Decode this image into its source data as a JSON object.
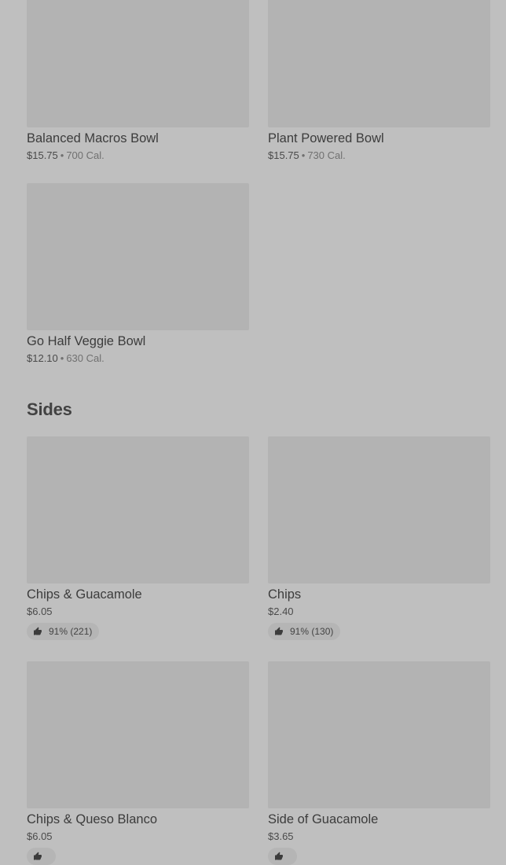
{
  "bowls": [
    {
      "name": "Balanced Macros Bowl",
      "price": "$15.75",
      "separator": "•",
      "calories": "700 Cal."
    },
    {
      "name": "Plant Powered Bowl",
      "price": "$15.75",
      "separator": "•",
      "calories": "730 Cal."
    },
    {
      "name": "Go Half Veggie Bowl",
      "price": "$12.10",
      "separator": "•",
      "calories": "630 Cal."
    }
  ],
  "sides_section": {
    "title": "Sides"
  },
  "sides": [
    {
      "name": "Chips & Guacamole",
      "price": "$6.05",
      "rating": "91% (221)",
      "icon": "thumbs-up-icon"
    },
    {
      "name": "Chips",
      "price": "$2.40",
      "rating": "91% (130)",
      "icon": "thumbs-up-icon"
    },
    {
      "name": "Chips & Queso Blanco",
      "price": "$6.05",
      "rating": "",
      "icon": "thumbs-up-icon"
    },
    {
      "name": "Side of Guacamole",
      "price": "$3.65",
      "rating": "",
      "icon": "thumbs-up-icon"
    }
  ],
  "colors": {
    "background": "#bfbfbf",
    "image_placeholder": "#b3b3b3",
    "badge": "#b5b5b5",
    "text": "#3c3c3c",
    "muted": "#707070"
  }
}
